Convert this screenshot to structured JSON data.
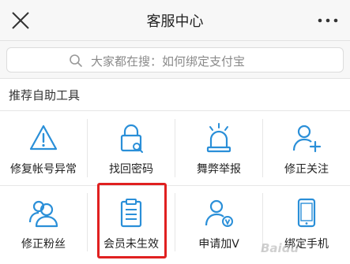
{
  "header": {
    "title": "客服中心"
  },
  "search": {
    "placeholder": "大家都在搜：如何绑定支付宝"
  },
  "section": {
    "title": "推荐自助工具"
  },
  "tools": [
    {
      "label": "修复帐号异常",
      "icon": "warning-icon"
    },
    {
      "label": "找回密码",
      "icon": "lock-icon"
    },
    {
      "label": "舞弊举报",
      "icon": "siren-icon"
    },
    {
      "label": "修正关注",
      "icon": "user-add-icon"
    },
    {
      "label": "修正粉丝",
      "icon": "users-icon"
    },
    {
      "label": "会员未生效",
      "icon": "clipboard-icon"
    },
    {
      "label": "申请加V",
      "icon": "user-verified-icon"
    },
    {
      "label": "绑定手机",
      "icon": "phone-icon"
    }
  ],
  "watermark": "Baidu",
  "colors": {
    "icon": "#2a8fd8",
    "highlight": "#e02020"
  }
}
